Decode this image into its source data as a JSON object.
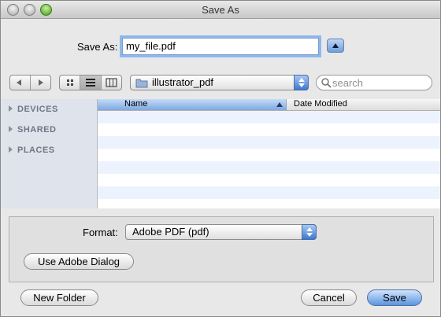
{
  "window": {
    "title": "Save As"
  },
  "save_as": {
    "label": "Save As:",
    "value": "my_file.pdf"
  },
  "toolbar": {
    "location": "illustrator_pdf",
    "search_placeholder": "search"
  },
  "sidebar": {
    "items": [
      {
        "label": "DEVICES"
      },
      {
        "label": "SHARED"
      },
      {
        "label": "PLACES"
      }
    ]
  },
  "file_list": {
    "columns": [
      "Name",
      "Date Modified"
    ]
  },
  "format": {
    "label": "Format:",
    "value": "Adobe PDF (pdf)"
  },
  "buttons": {
    "use_adobe_dialog": "Use Adobe Dialog",
    "new_folder": "New Folder",
    "cancel": "Cancel",
    "save": "Save"
  },
  "colors": {
    "accent": "#5b94df",
    "sidebar_bg": "#dfe4ec",
    "row_stripe": "#edf3fe"
  }
}
